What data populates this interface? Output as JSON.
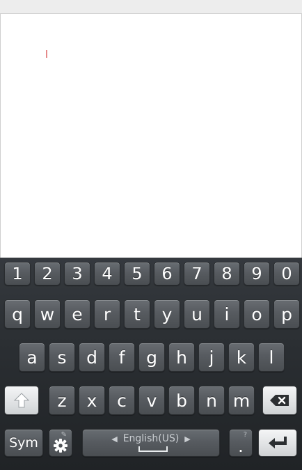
{
  "keyboard": {
    "number_row": [
      "1",
      "2",
      "3",
      "4",
      "5",
      "6",
      "7",
      "8",
      "9",
      "0"
    ],
    "row1": [
      "q",
      "w",
      "e",
      "r",
      "t",
      "y",
      "u",
      "i",
      "o",
      "p"
    ],
    "row2": [
      "a",
      "s",
      "d",
      "f",
      "g",
      "h",
      "j",
      "k",
      "l"
    ],
    "row3": [
      "z",
      "x",
      "c",
      "v",
      "b",
      "n",
      "m"
    ],
    "sym_label": "Sym",
    "language_label": "English(US)",
    "period_label": ".",
    "period_hint": "?",
    "settings_hint": "✎"
  },
  "colors": {
    "keyboard_bg": "#2b2f33",
    "key_dark": "#575b60",
    "key_light": "#dfe1e3",
    "caret": "#e58a8a"
  }
}
